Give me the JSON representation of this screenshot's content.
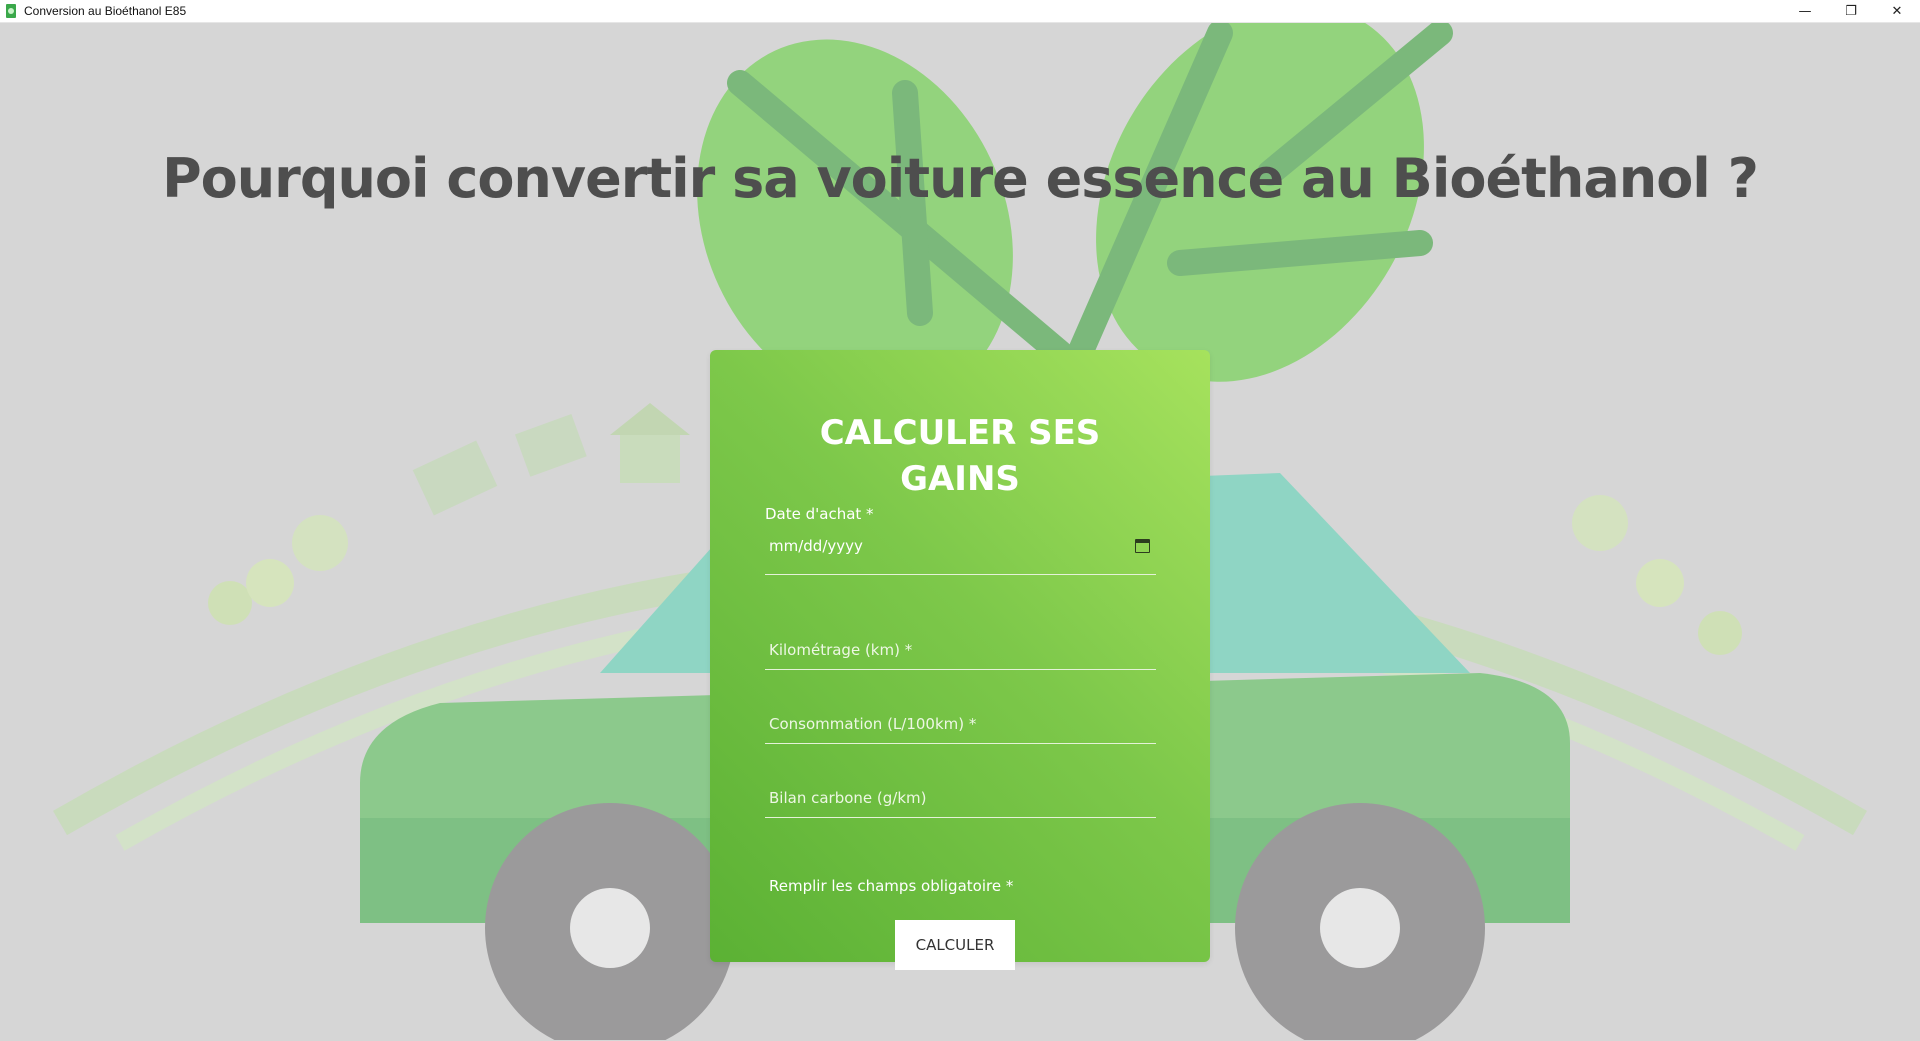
{
  "window": {
    "title": "Conversion au Bioéthanol E85",
    "minimize_glyph": "—",
    "restore_glyph": "❐",
    "close_glyph": "✕"
  },
  "page": {
    "headline": "Pourquoi convertir sa voiture essence au Bioéthanol ?"
  },
  "form": {
    "title_line1": "CALCULER SES",
    "title_line2": "GAINS",
    "date": {
      "label": "Date d'achat *",
      "value": "mm/dd/yyyy"
    },
    "mileage": {
      "placeholder": "Kilométrage (km) *"
    },
    "consumption": {
      "placeholder": "Consommation (L/100km) *"
    },
    "carbon": {
      "placeholder": "Bilan carbone (g/km)"
    },
    "required_note": "Remplir les champs obligatoire *",
    "submit_label": "CALCULER"
  },
  "colors": {
    "accent_green": "#7dc84a",
    "background": "#d6d6d6",
    "headline": "#4e4e4e"
  },
  "icons": [
    "app-icon",
    "calendar-icon",
    "minimize-icon",
    "restore-icon",
    "close-icon"
  ]
}
